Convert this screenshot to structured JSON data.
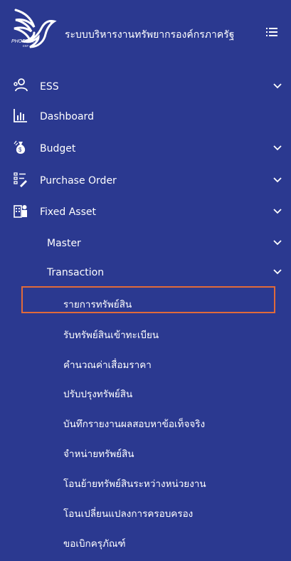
{
  "header": {
    "logo_text": "PHOENIX",
    "logo_sub": "ERP",
    "title": "ระบบบริหารงานทรัพยากรองค์กรภาครัฐ",
    "menu_icon": "hamburger-list-icon"
  },
  "menu": [
    {
      "label": "ESS",
      "icon": "people-icon",
      "chevron": true
    },
    {
      "label": "Dashboard",
      "icon": "bar-chart-icon",
      "chevron": false
    },
    {
      "label": "Budget",
      "icon": "money-bag-icon",
      "chevron": true
    },
    {
      "label": "Purchase Order",
      "icon": "order-list-icon",
      "chevron": true
    },
    {
      "label": "Fixed Asset",
      "icon": "building-icon",
      "chevron": true
    },
    {
      "label": "Master",
      "chevron": true
    },
    {
      "label": "Transaction",
      "chevron": true
    }
  ],
  "transaction_items": [
    "รายการทรัพย์สิน",
    "รับทรัพย์สินเข้าทะเบียน",
    "คำนวณค่าเสื่อมราคา",
    "ปรับปรุงทรัพย์สิน",
    "บันทึกรายงานผลสอบหาข้อเท็จจริง",
    "จำหน่ายทรัพย์สิน",
    "โอนย้ายทรัพย์สินระหว่างหน่วยงาน",
    "โอนเปลี่ยนแปลงการครอบครอง",
    "ขอเบิกครุภัณฑ์"
  ],
  "selected_item": "รายการทรัพย์สิน",
  "colors": {
    "sidebar_bg": "#2b3990",
    "text": "#ffffff",
    "highlight_border": "#e06a3a"
  }
}
